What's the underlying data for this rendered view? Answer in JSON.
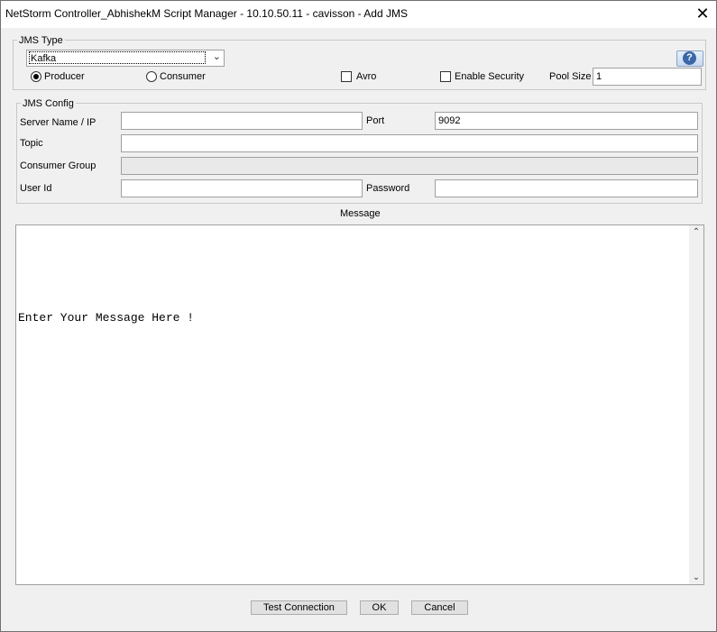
{
  "window": {
    "title": "NetStorm Controller_AbhishekM Script Manager - 10.10.50.11 - cavisson - Add JMS",
    "close_glyph": "✕"
  },
  "jms_type": {
    "legend": "JMS Type",
    "type_selected": "Kafka",
    "producer_label": "Producer",
    "producer_selected": true,
    "consumer_label": "Consumer",
    "avro_label": "Avro",
    "avro_checked": false,
    "enable_security_label": "Enable Security",
    "enable_security_checked": false,
    "pool_size_label": "Pool Size",
    "pool_size_value": "1",
    "help_glyph": "?"
  },
  "jms_config": {
    "legend": "JMS Config",
    "server_label": "Server Name / IP",
    "server_value": "",
    "port_label": "Port",
    "port_value": "9092",
    "topic_label": "Topic",
    "topic_value": "",
    "consumer_group_label": "Consumer Group",
    "consumer_group_value": "",
    "user_id_label": "User Id",
    "user_id_value": "",
    "password_label": "Password",
    "password_value": ""
  },
  "message": {
    "label": "Message",
    "text": "Enter Your Message Here !"
  },
  "buttons": {
    "test_connection": "Test Connection",
    "ok": "OK",
    "cancel": "Cancel"
  }
}
